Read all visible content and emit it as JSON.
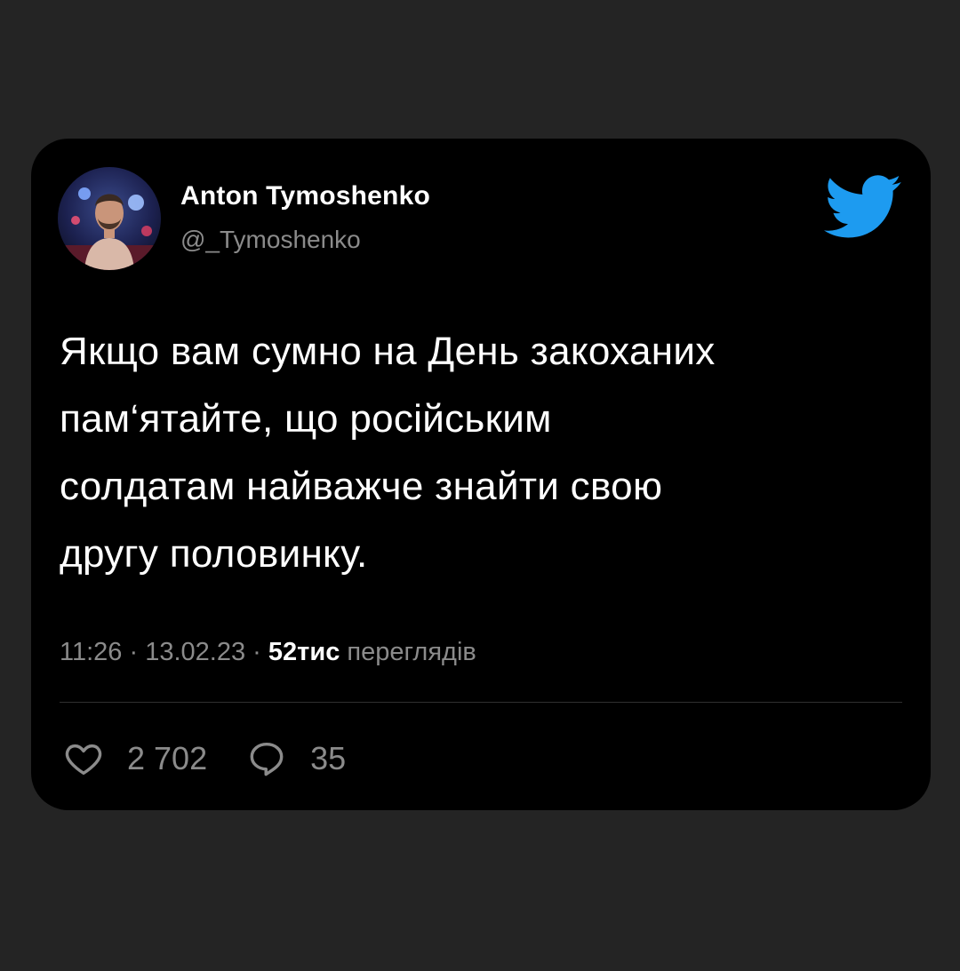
{
  "tweet": {
    "author": {
      "display_name": "Anton Tymoshenko",
      "handle": "@_Tymoshenko",
      "avatar_icon": "avatar-photo"
    },
    "brand_icon": "twitter-bird-icon",
    "brand_color": "#1d9bf0",
    "text_lines": [
      "Якщо вам сумно на День закоханих",
      "пам‘ятайте, що російським",
      "солдатам найважче знайти свою",
      "другу половинку."
    ],
    "meta": {
      "time": "11:26",
      "separator": "·",
      "date": "13.02.23",
      "views_count": "52тис",
      "views_label": "переглядів"
    },
    "actions": {
      "likes_icon": "heart-icon",
      "likes_count": "2 702",
      "replies_icon": "reply-bubble-icon",
      "replies_count": "35"
    }
  }
}
